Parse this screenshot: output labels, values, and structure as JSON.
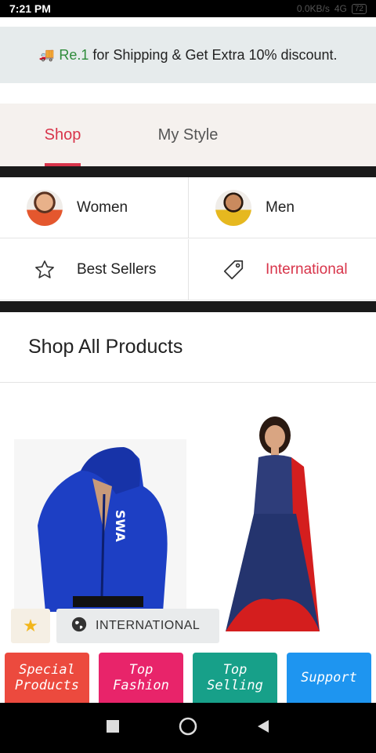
{
  "status": {
    "time": "7:21 PM",
    "net": "0.0KB/s",
    "signal": "4G",
    "battery": "72"
  },
  "promo": {
    "highlight": "Re.1",
    "text": "for Shipping & Get Extra 10% discount."
  },
  "tabs": [
    {
      "label": "Shop",
      "active": true
    },
    {
      "label": "My Style",
      "active": false
    }
  ],
  "categories": {
    "women": "Women",
    "men": "Men",
    "best_sellers": "Best Sellers",
    "international": "International"
  },
  "section_title": "Shop All Products",
  "chip": {
    "label": "INTERNATIONAL"
  },
  "tiles": [
    {
      "line1": "Special",
      "line2": "Products",
      "color": "#ec4a3e"
    },
    {
      "line1": "Top",
      "line2": "Fashion",
      "color": "#e8246a"
    },
    {
      "line1": "Top",
      "line2": "Selling",
      "color": "#17a089"
    },
    {
      "line1": "Support",
      "line2": "",
      "color": "#1e95f0"
    }
  ],
  "colors": {
    "accent": "#d8344a",
    "promo_green": "#2e8b3a"
  }
}
